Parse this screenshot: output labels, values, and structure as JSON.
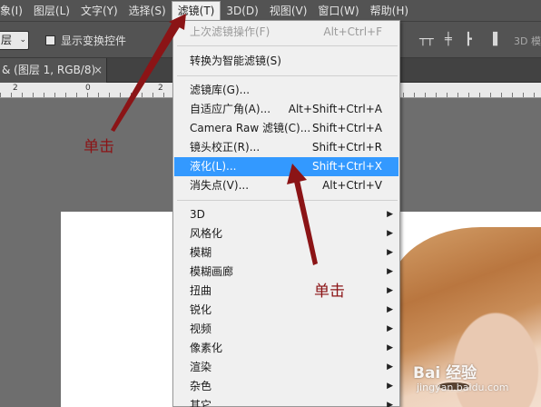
{
  "menubar": {
    "items": [
      {
        "label": "象(I)"
      },
      {
        "label": "图层(L)"
      },
      {
        "label": "文字(Y)"
      },
      {
        "label": "选择(S)"
      },
      {
        "label": "滤镜(T)"
      },
      {
        "label": "3D(D)"
      },
      {
        "label": "视图(V)"
      },
      {
        "label": "窗口(W)"
      },
      {
        "label": "帮助(H)"
      }
    ]
  },
  "options": {
    "layer_select": "层",
    "show_transform_label": "显示变换控件",
    "threed_label": "3D 模"
  },
  "tab": {
    "title": "& (图层 1, RGB/8)",
    "close": "×"
  },
  "ruler": {
    "labels": [
      "2",
      "0",
      "2"
    ]
  },
  "filter_menu": {
    "items": [
      {
        "label": "上次滤镜操作(F)",
        "shortcut": "Alt+Ctrl+F",
        "disabled": true
      },
      {
        "label": "转换为智能滤镜(S)",
        "shortcut": ""
      },
      {
        "label": "滤镜库(G)...",
        "shortcut": ""
      },
      {
        "label": "自适应广角(A)...",
        "shortcut": "Alt+Shift+Ctrl+A"
      },
      {
        "label": "Camera Raw 滤镜(C)...",
        "shortcut": "Shift+Ctrl+A"
      },
      {
        "label": "镜头校正(R)...",
        "shortcut": "Shift+Ctrl+R"
      },
      {
        "label": "液化(L)...",
        "shortcut": "Shift+Ctrl+X",
        "highlighted": true
      },
      {
        "label": "消失点(V)...",
        "shortcut": "Alt+Ctrl+V"
      },
      {
        "label": "3D",
        "submenu": true
      },
      {
        "label": "风格化",
        "submenu": true
      },
      {
        "label": "模糊",
        "submenu": true
      },
      {
        "label": "模糊画廊",
        "submenu": true
      },
      {
        "label": "扭曲",
        "submenu": true
      },
      {
        "label": "锐化",
        "submenu": true
      },
      {
        "label": "视频",
        "submenu": true
      },
      {
        "label": "像素化",
        "submenu": true
      },
      {
        "label": "渲染",
        "submenu": true
      },
      {
        "label": "杂色",
        "submenu": true
      },
      {
        "label": "其它",
        "submenu": true
      }
    ]
  },
  "annotations": {
    "click_1": "单击",
    "click_2": "单击"
  },
  "watermark": {
    "text": "Bai 经验",
    "sub": "jingyan.baidu.com"
  },
  "colors": {
    "highlight": "#3399ff",
    "annotation": "#8b1416",
    "workspace": "#6e6e6e"
  }
}
